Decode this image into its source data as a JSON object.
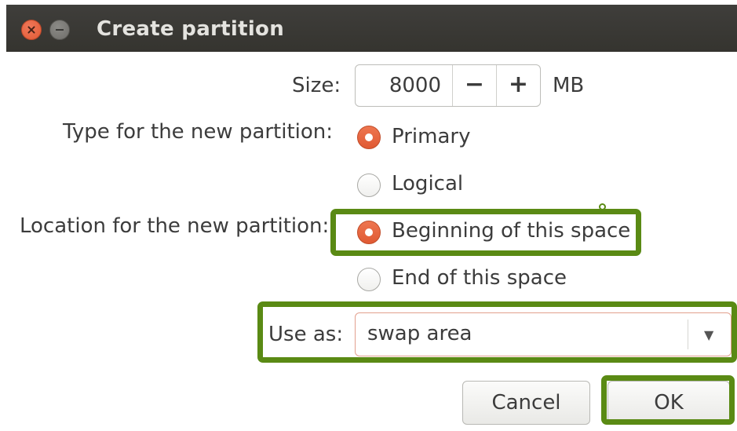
{
  "window": {
    "title": "Create partition"
  },
  "size": {
    "label": "Size:",
    "value": "8000",
    "decrement": "−",
    "increment": "+",
    "unit": "MB"
  },
  "type": {
    "label": "Type for the new partition:",
    "options": [
      {
        "label": "Primary",
        "selected": true
      },
      {
        "label": "Logical",
        "selected": false
      }
    ]
  },
  "location": {
    "label": "Location for the new partition:",
    "options": [
      {
        "label": "Beginning of this space",
        "selected": true
      },
      {
        "label": "End of this space",
        "selected": false
      }
    ]
  },
  "use_as": {
    "label": "Use as:",
    "value": "swap area"
  },
  "buttons": {
    "cancel": "Cancel",
    "ok": "OK"
  },
  "colors": {
    "accent": "#e05a33",
    "highlight": "#5a8a14",
    "titlebar": "#3c3b37"
  }
}
